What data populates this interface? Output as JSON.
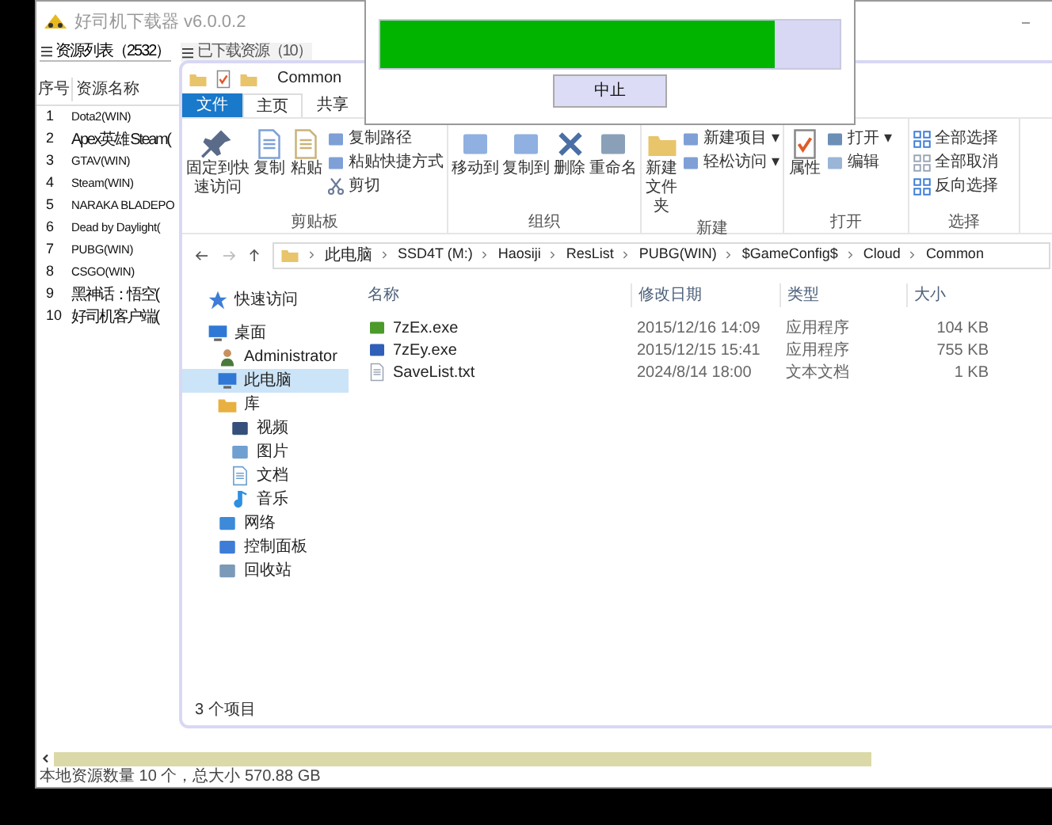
{
  "app": {
    "title": "好司机下载器 v6.0.0.2",
    "tabs": [
      {
        "label": "资源列表（2532）",
        "selected": true
      },
      {
        "label": "已下载资源（10）",
        "selected": false
      }
    ],
    "columns": [
      "序号",
      "资源名称"
    ],
    "rows": [
      {
        "index": "1",
        "name": "Dota2(WIN)"
      },
      {
        "index": "2",
        "name": "Apex英雄 Steam("
      },
      {
        "index": "3",
        "name": "GTAV(WIN)"
      },
      {
        "index": "4",
        "name": "Steam(WIN)"
      },
      {
        "index": "5",
        "name": "NARAKA BLADEPO"
      },
      {
        "index": "6",
        "name": "Dead by Daylight("
      },
      {
        "index": "7",
        "name": "PUBG(WIN)"
      },
      {
        "index": "8",
        "name": "CSGO(WIN)"
      },
      {
        "index": "9",
        "name": "黑神话：悟空("
      },
      {
        "index": "10",
        "name": "好司机客户端("
      }
    ],
    "status": "本地资源数量 10 个，总大小 570.88 GB"
  },
  "explorer": {
    "title": "Common",
    "ribbon_tabs": [
      {
        "label": "文件",
        "kind": "file",
        "selected": false
      },
      {
        "label": "主页",
        "kind": "tab",
        "selected": true
      },
      {
        "label": "共享",
        "kind": "tab",
        "selected": false
      }
    ],
    "groups": [
      {
        "label": "剪贴板",
        "big": [
          "固定到快速访问",
          "复制",
          "粘贴"
        ],
        "small": [
          "复制路径",
          "粘贴快捷方式",
          "剪切"
        ]
      },
      {
        "label": "组织",
        "big": [
          "移动到",
          "复制到",
          "删除",
          "重命名"
        ]
      },
      {
        "label": "新建",
        "big": [
          "新建文件夹"
        ],
        "small": [
          "新建项目 ▾",
          "轻松访问 ▾"
        ]
      },
      {
        "label": "打开",
        "big": [
          "属性"
        ],
        "small": [
          "打开 ▾",
          "编辑"
        ]
      },
      {
        "label": "选择",
        "small": [
          "全部选择",
          "全部取消",
          "反向选择"
        ]
      }
    ],
    "breadcrumb": [
      "此电脑",
      "SSD4T (M:)",
      "Haosiji",
      "ResList",
      "PUBG(WIN)",
      "$GameConfig$",
      "Cloud",
      "Common"
    ],
    "nav": [
      {
        "label": "快速访问",
        "selected": false
      },
      {
        "label": "桌面",
        "selected": false,
        "children": [
          {
            "label": "Administrator",
            "selected": false
          },
          {
            "label": "此电脑",
            "selected": true
          },
          {
            "label": "库",
            "selected": false,
            "children": [
              {
                "label": "视频",
                "selected": false
              },
              {
                "label": "图片",
                "selected": false
              },
              {
                "label": "文档",
                "selected": false
              },
              {
                "label": "音乐",
                "selected": false
              }
            ]
          },
          {
            "label": "网络",
            "selected": false
          },
          {
            "label": "控制面板",
            "selected": false
          },
          {
            "label": "回收站",
            "selected": false
          }
        ]
      }
    ],
    "columns": [
      "名称",
      "修改日期",
      "类型",
      "大小"
    ],
    "files": [
      {
        "name": "7zEx.exe",
        "date": "2015/12/16 14:09",
        "type": "应用程序",
        "size": "104 KB"
      },
      {
        "name": "7zEy.exe",
        "date": "2015/12/15 15:41",
        "type": "应用程序",
        "size": "755 KB"
      },
      {
        "name": "SaveList.txt",
        "date": "2024/8/14 18:00",
        "type": "文本文档",
        "size": "1 KB"
      }
    ],
    "status": "3 个项目"
  },
  "dialog": {
    "level": 0.86,
    "button": "中止"
  }
}
